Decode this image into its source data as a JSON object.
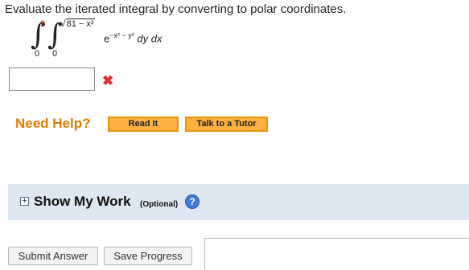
{
  "question": {
    "prompt": "Evaluate the iterated integral by converting to polar coordinates.",
    "outer_upper_limit": "9",
    "outer_lower_limit": "0",
    "inner_upper_limit_radicand": "81 − x²",
    "inner_lower_limit": "0",
    "integrand_base": "e",
    "integrand_exponent": "−x² − y²",
    "differentials": "dy dx"
  },
  "answer": {
    "value": "",
    "status": "incorrect",
    "status_icon": "x-mark-icon",
    "status_color": "#e03030"
  },
  "help": {
    "label": "Need Help?",
    "read_label": "Read It",
    "tutor_label": "Talk to a Tutor"
  },
  "show_my_work": {
    "title": "Show My Work",
    "optional": "(Optional)",
    "help_glyph": "?"
  },
  "actions": {
    "submit_label": "Submit Answer",
    "save_label": "Save Progress"
  },
  "colors": {
    "accent_orange": "#e07b00",
    "button_orange": "#fbb040",
    "panel_blue": "#dde8f3",
    "help_blue": "#3f7bd6"
  }
}
